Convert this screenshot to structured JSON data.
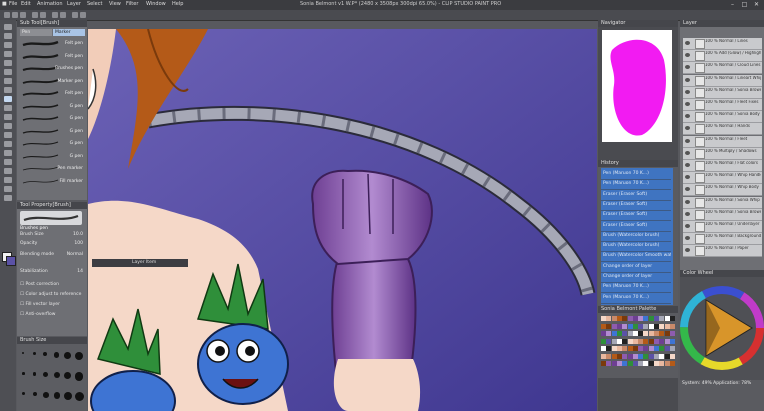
{
  "window": {
    "title": "Sonia Belmont v1 W.P* (2480 x 3508px 300dpi 65.0%) - CLIP STUDIO PAINT PRO",
    "minimize": "–",
    "maximize": "□",
    "close": "✕"
  },
  "menu": [
    "File",
    "Edit",
    "Animation",
    "Layer",
    "Select",
    "View",
    "Filter",
    "Window",
    "Help"
  ],
  "sub_tool": {
    "header": "Sub Tool[Brush]",
    "tabs": [
      "Pen",
      "Marker"
    ],
    "brushes": [
      "Felt pen",
      "Felt pen",
      "Brushes pen",
      "Marker pen",
      "Felt pen",
      "G pen",
      "G pen",
      "G pen",
      "G pen",
      "G pen",
      "Pen marker",
      "Fill marker"
    ]
  },
  "tool_property": {
    "header": "Tool Property[Brush]",
    "brush_name": "Brushes pen",
    "brush_size_label": "Brush Size",
    "brush_size_value": "10.0",
    "opacity_label": "Opacity",
    "opacity_value": "100",
    "blending_label": "Blending mode",
    "blending_value": "Normal",
    "stabilization_label": "Stabilization",
    "stabilization_value": "14",
    "post_correction": "Post correction",
    "antialias_label": "Color adjust to reference",
    "vector_label": "Fill vector layer",
    "anti_overflow": "Anti-overflow"
  },
  "brush_size_panel": {
    "header": "Brush Size"
  },
  "canvas_tab": {
    "label": "Layer Item"
  },
  "navigator": {
    "header": "Navigator"
  },
  "history": {
    "header": "History",
    "items": [
      "Pen (Maruon 70 K...)",
      "Pen (Maruon 70 K...)",
      "Eraser (Eraser Soft)",
      "Eraser (Eraser Soft)",
      "Eraser (Eraser Soft)",
      "Eraser (Eraser Soft)",
      "Brush (Watercolor brush)",
      "Brush (Watercolor brush)",
      "Brush (Watercolor Smooth watercolor)",
      "Change order of layer",
      "Change order of layer",
      "Pen (Maruon 70 K...)",
      "Pen (Maruon 70 K...)"
    ]
  },
  "color_set": {
    "header": "Sonia Belmont Palette"
  },
  "layer_panel": {
    "header": "Layer",
    "layers": [
      "100 % Normal / Lines",
      "100 % Add (Glow) / Highlights",
      "100 % Normal / Cloud Lines",
      "100 % Normal / Lineart Whip",
      "100 % Normal / Sonia Brows",
      "100 % Normal / Fleet Fixes",
      "100 % Normal / Sonia Body",
      "100 % Normal / Hands",
      "100 % Normal / Fleet",
      "100 % Multiply / Shadows",
      "100 % Normal / Flat colors",
      "100 % Normal / Whip Handle",
      "100 % Normal / Whip Body",
      "100 % Normal / Sonia Whip",
      "100 % Normal / Sonia Brows",
      "100 % Normal / Underlayer",
      "100 % Normal / Background",
      "100 % Normal / Paper"
    ]
  },
  "color_wheel": {
    "header": "Color Wheel"
  },
  "status": {
    "memory": "System: 49%  Application: 78%"
  },
  "colors": {
    "canvas_bg": "#5b52a6",
    "whip": "#a6a8b6",
    "glove": "#8e5cae",
    "navigator_blob": "#f21bf2",
    "history_selected": "#3f74c1"
  }
}
